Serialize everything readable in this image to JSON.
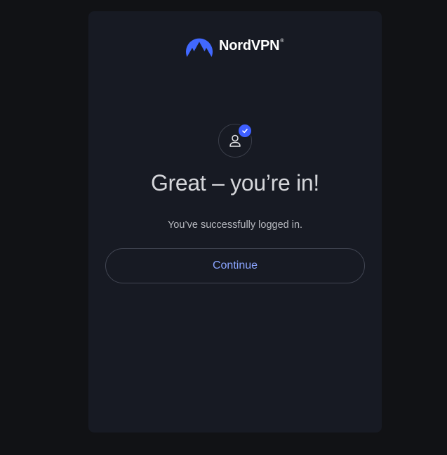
{
  "brand": {
    "name": "NordVPN",
    "registered_mark": "®",
    "logo_icon": "nordvpn-mountain-logo",
    "color": "#4168ff"
  },
  "status": {
    "avatar_icon": "user-icon",
    "badge_icon": "checkmark-icon",
    "badge_color": "#3e5fff"
  },
  "main": {
    "heading": "Great – you’re in!",
    "message": "You’ve successfully logged in.",
    "continue_label": "Continue",
    "accent_color": "#8aa4ff"
  }
}
